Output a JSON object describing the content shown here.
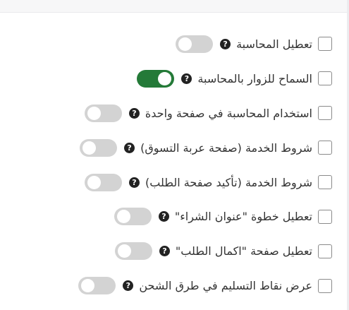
{
  "settings": {
    "items": [
      {
        "label": "تعطيل المحاسبة",
        "help": "?",
        "enabled": false
      },
      {
        "label": "السماح للزوار بالمحاسبة",
        "help": "?",
        "enabled": true
      },
      {
        "label": "استخدام المحاسبة في صفحة واحدة",
        "help": "?",
        "enabled": false
      },
      {
        "label": "شروط الخدمة (صفحة عربة التسوق)",
        "help": "?",
        "enabled": false
      },
      {
        "label": "شروط الخدمة (تأكيد صفحة الطلب)",
        "help": "?",
        "enabled": false
      },
      {
        "label": "تعطيل خطوة \"عنوان الشراء\"",
        "help": "?",
        "enabled": false
      },
      {
        "label": "تعطيل صفحة \"اكمال الطلب\"",
        "help": "?",
        "enabled": false
      },
      {
        "label": "عرض نقاط التسليم في طرق الشحن",
        "help": "?",
        "enabled": false
      }
    ]
  },
  "colors": {
    "toggle_on": "#247a38",
    "toggle_off": "#d3d3d3"
  }
}
